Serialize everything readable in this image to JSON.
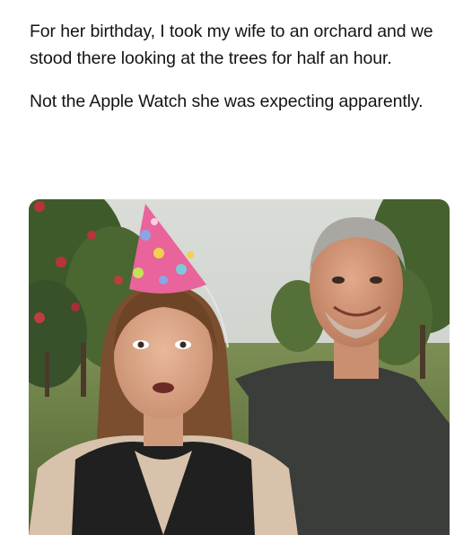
{
  "post": {
    "line1": "For her birthday, I took my wife to an orchard and we stood there looking at the trees for half an hour.",
    "line2": "Not the Apple Watch she was expecting apparently."
  },
  "photo": {
    "subject": "Woman in a pink polka-dot party hat with a shocked expression standing in an apple orchard, a smiling gray-haired man behind her"
  },
  "colors": {
    "text": "#141414",
    "background": "#ffffff",
    "party_hat": "#e8649a"
  }
}
